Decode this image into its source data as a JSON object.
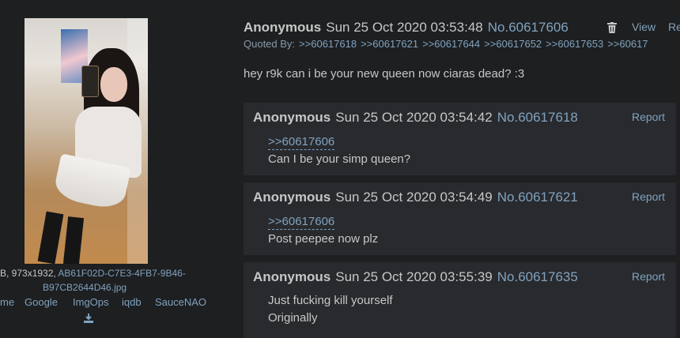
{
  "file": {
    "info_line1": "B, 973x1932, AB61F02D-C7E3-4FB7-9B46-",
    "info_line2": "B97CB2644D46.jpg",
    "services": [
      "me",
      "Google",
      "ImgOps",
      "iqdb",
      "SauceNAO"
    ]
  },
  "op": {
    "name": "Anonymous",
    "date": "Sun 25 Oct 2020 03:53:48",
    "number": "No.60617606",
    "view_label": "View",
    "report_label": "Re",
    "quoted_by_label": "Quoted By:",
    "quoted_by": [
      ">>60617618",
      ">>60617621",
      ">>60617644",
      ">>60617652",
      ">>60617653",
      ">>60617"
    ],
    "text": "hey r9k can i be your new queen now ciaras dead? :3"
  },
  "replies": [
    {
      "name": "Anonymous",
      "date": "Sun 25 Oct 2020 03:54:42",
      "number": "No.60617618",
      "report_label": "Report",
      "quote": ">>60617606",
      "lines": [
        "Can I be your simp queen?"
      ]
    },
    {
      "name": "Anonymous",
      "date": "Sun 25 Oct 2020 03:54:49",
      "number": "No.60617621",
      "report_label": "Report",
      "quote": ">>60617606",
      "lines": [
        "Post peepee now plz"
      ]
    },
    {
      "name": "Anonymous",
      "date": "Sun 25 Oct 2020 03:55:39",
      "number": "No.60617635",
      "report_label": "Report",
      "lines": [
        "Just fucking kill yourself",
        "Originally"
      ]
    }
  ],
  "icons": {
    "trash": "trash-icon",
    "download": "download-icon"
  },
  "colors": {
    "background": "#1d1f21",
    "post_background": "#282a2e",
    "text": "#c5c8c6",
    "link": "#81a2be"
  }
}
